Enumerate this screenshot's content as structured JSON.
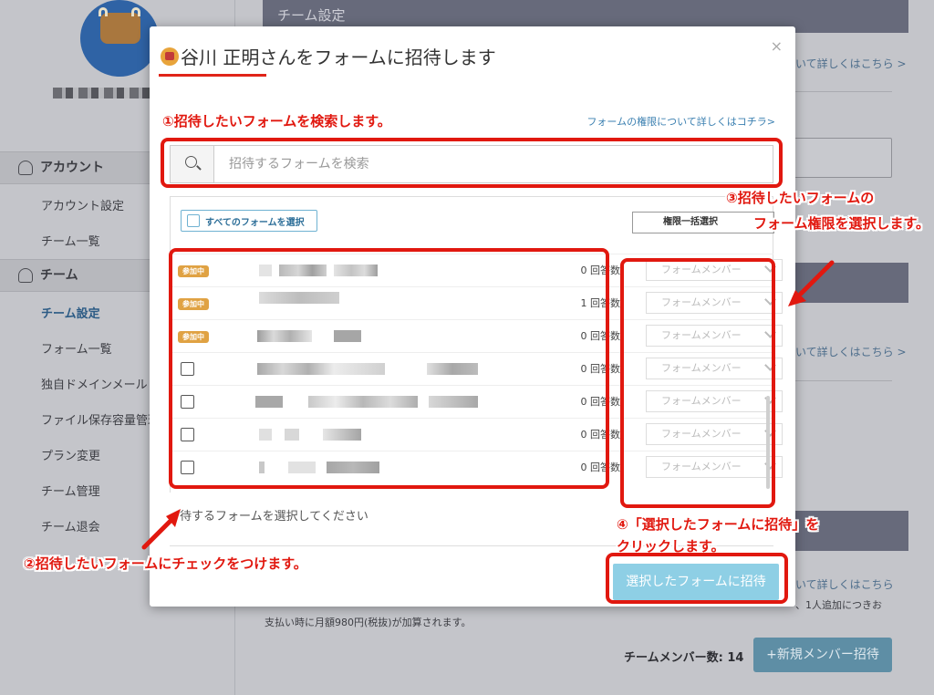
{
  "background": {
    "header_title": "チーム設定",
    "sidebar": {
      "groups": [
        {
          "label": "アカウント",
          "items": [
            "アカウント設定",
            "チーム一覧"
          ]
        },
        {
          "label": "チーム",
          "items": [
            "チーム設定",
            "フォーム一覧",
            "独自ドメインメール",
            "ファイル保存容量管理",
            "プラン変更",
            "チーム管理",
            "チーム退会"
          ]
        }
      ]
    },
    "links": [
      "いて詳しくはこちら >",
      "いて詳しくはこちら >",
      "いて詳しくはこちら"
    ],
    "text_line_1": "、1人追加につきお",
    "text_line_2": "支払い時に月額980円(税抜)が加算されます。",
    "team_member_count": "チームメンバー数: 14",
    "new_member_button": "+新規メンバー招待"
  },
  "modal": {
    "title_name": "谷川 正明",
    "title_rest": " さんをフォームに招待します",
    "close_icon": "×",
    "permission_link": "フォームの権限について詳しくはコチラ>",
    "search_placeholder": "招待するフォームを検索",
    "select_all_label": "すべてのフォームを選択",
    "bulk_permission_label": "権限一括選択",
    "joined_badge": "参加中",
    "rows": [
      {
        "joined": true,
        "count": "0 回答数",
        "permission": "フォームメンバー"
      },
      {
        "joined": true,
        "count": "1 回答数",
        "permission": "フォームメンバー"
      },
      {
        "joined": true,
        "count": "0 回答数",
        "permission": "フォームメンバー"
      },
      {
        "joined": false,
        "count": "0 回答数",
        "permission": "フォームメンバー"
      },
      {
        "joined": false,
        "count": "0 回答数",
        "permission": "フォームメンバー"
      },
      {
        "joined": false,
        "count": "0 回答数",
        "permission": "フォームメンバー"
      },
      {
        "joined": false,
        "count": "0 回答数",
        "permission": "フォームメンバー"
      }
    ],
    "helper_text": "待するフォームを選択してください",
    "invite_button": "選択したフォームに招待"
  },
  "annotations": {
    "step1": "①招待したいフォームを検索します。",
    "step2": "②招待したいフォームにチェックをつけます。",
    "step3_line1": "③招待したいフォームの",
    "step3_line2": "フォーム権限を選択します。",
    "step4_line1": "④「選択したフォームに招待」を",
    "step4_line2": "クリックします。",
    "color": "#e1180f"
  },
  "colors": {
    "accent": "#8ecfe5",
    "badge": "#e0a243",
    "link": "#3a7fb0"
  }
}
